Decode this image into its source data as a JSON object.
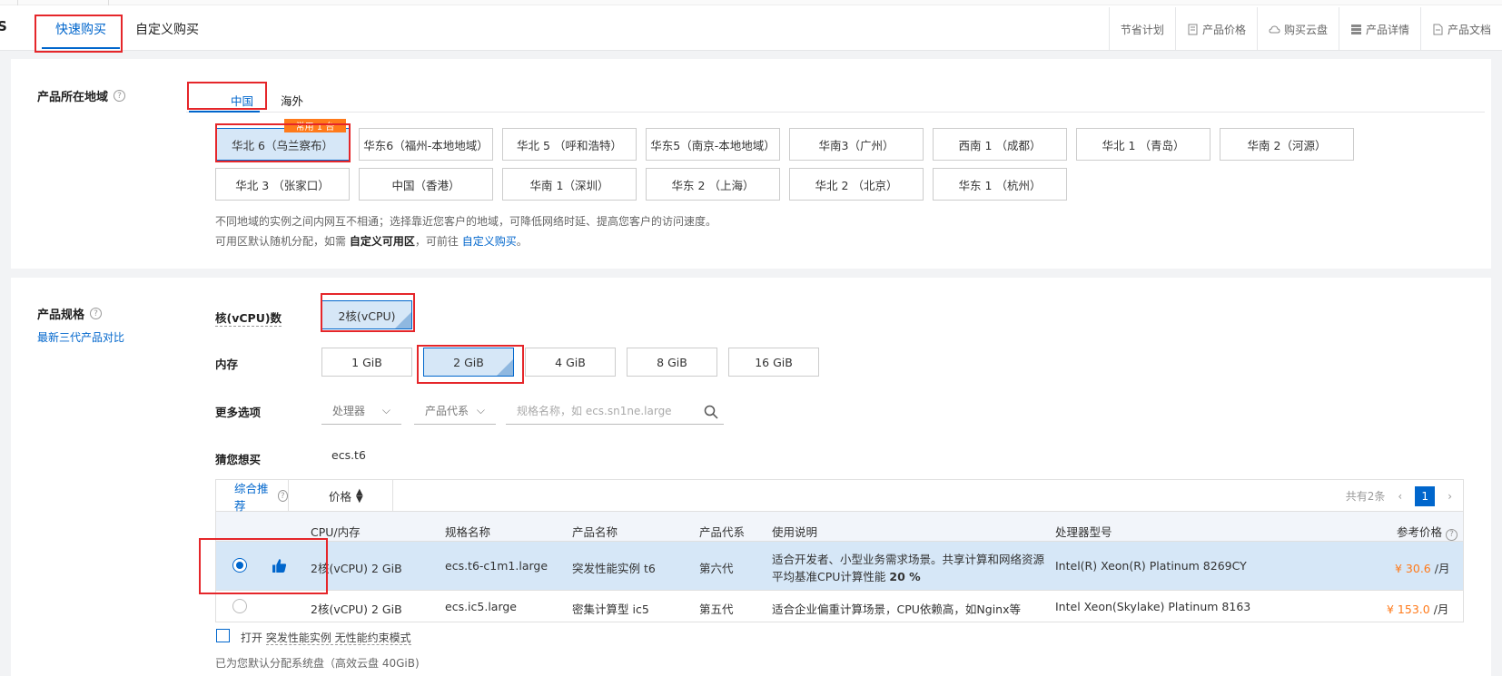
{
  "header": {
    "logo_char": "S",
    "tabs": [
      "快速购买",
      "自定义购买"
    ],
    "links": [
      {
        "label": "节省计划",
        "icon": "none"
      },
      {
        "label": "产品价格",
        "icon": "price-doc-icon"
      },
      {
        "label": "购买云盘",
        "icon": "cloud-icon"
      },
      {
        "label": "产品详情",
        "icon": "detail-icon"
      },
      {
        "label": "产品文档",
        "icon": "doc-icon"
      }
    ]
  },
  "region": {
    "label": "产品所在地域",
    "tabs": [
      "中国",
      "海外"
    ],
    "badge": "常用 1 台",
    "options_row1": [
      "华北 6（乌兰察布）",
      "华东6（福州-本地地域）",
      "华北 5 （呼和浩特）",
      "华东5（南京-本地地域）",
      "华南3（广州）",
      "西南 1 （成都）",
      "华北 1 （青岛）",
      "华南 2（河源）"
    ],
    "options_row2": [
      "华北 3 （张家口）",
      "中国（香港）",
      "华南 1（深圳）",
      "华东 2 （上海）",
      "华北 2 （北京）",
      "华东 1 （杭州）"
    ],
    "selected": "华北 6（乌兰察布）",
    "note1": "不同地域的实例之间内网互不相通；选择靠近您客户的地域，可降低网络时延、提高您客户的访问速度。",
    "note2_prefix": "可用区默认随机分配，如需",
    "note2_bold": "自定义可用区",
    "note2_mid": "，可前往",
    "note2_link": "自定义购买",
    "note2_suffix": "。"
  },
  "spec": {
    "label": "产品规格",
    "compare_link": "最新三代产品对比",
    "cpu_label": "核(vCPU)数",
    "cpu_options": [
      "2核(vCPU)"
    ],
    "mem_label": "内存",
    "mem_options": [
      "1 GiB",
      "2 GiB",
      "4 GiB",
      "8 GiB",
      "16 GiB"
    ],
    "mem_selected": "2 GiB",
    "more_label": "更多选项",
    "processor_dd": "处理器",
    "gen_dd": "产品代系",
    "search_placeholder": "规格名称，如 ecs.sn1ne.large",
    "guess_label": "猜您想买",
    "guess_value": "ecs.t6"
  },
  "table": {
    "tab_recommend": "综合推荐",
    "tab_price": "价格",
    "total": "共有2条",
    "page": "1",
    "headers": [
      "CPU/内存",
      "规格名称",
      "产品名称",
      "产品代系",
      "使用说明",
      "处理器型号",
      "参考价格"
    ],
    "rows": [
      {
        "cpu_mem": "2核(vCPU) 2 GiB",
        "spec": "ecs.t6-c1m1.large",
        "product": "突发性能实例 t6",
        "gen": "第六代",
        "desc1": "适合开发者、小型业务需求场景。共享计算和网络资源",
        "desc2_prefix": "平均基准CPU计算性能 ",
        "desc2_bold": "20 %",
        "cpu_model": "Intel(R) Xeon(R) Platinum 8269CY",
        "price": "¥ 30.6",
        "unit": "/月"
      },
      {
        "cpu_mem": "2核(vCPU) 2 GiB",
        "spec": "ecs.ic5.large",
        "product": "密集计算型 ic5",
        "gen": "第五代",
        "desc1": "适合企业偏重计算场景，CPU依赖高，如Nginx等",
        "cpu_model": "Intel Xeon(Skylake) Platinum 8163",
        "price": "¥ 153.0",
        "unit": "/月"
      }
    ]
  },
  "burst": {
    "checkbox_prefix": "打开 ",
    "checkbox_link": "突发性能实例 无性能约束模式",
    "disk_note": "已为您默认分配系统盘（高效云盘 40GiB)"
  },
  "colors": {
    "accent": "#0066cc",
    "selected_bg": "#d6e7f7",
    "price": "#ff7a1a",
    "highlight_box": "#e5262a"
  }
}
